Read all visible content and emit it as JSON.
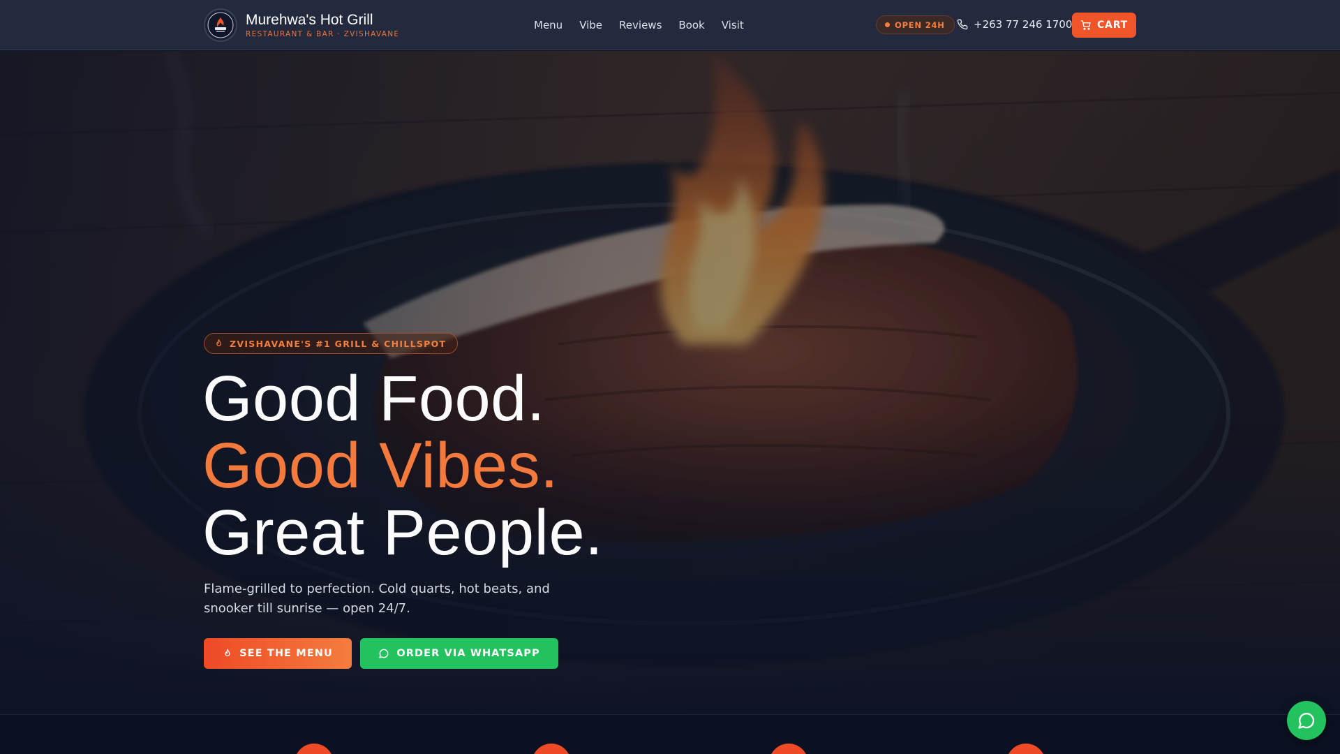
{
  "brand": {
    "name": "Murehwa's Hot Grill",
    "subtitle": "RESTAURANT & BAR · ZVISHAVANE"
  },
  "nav": {
    "links": [
      "Menu",
      "Vibe",
      "Reviews",
      "Book",
      "Visit"
    ]
  },
  "header": {
    "status": "OPEN 24H",
    "phone": "+263 77 246 1700",
    "cart_label": "CART"
  },
  "hero": {
    "tagline": "ZVISHAVANE'S #1 GRILL & CHILLSPOT",
    "headline_1": "Good Food.",
    "headline_2": "Good Vibes.",
    "headline_3": "Great People.",
    "lead": "Flame-grilled to perfection. Cold quarts, hot beats, and snooker till sunrise — open 24/7.",
    "cta_menu": "SEE THE MENU",
    "cta_whatsapp": "ORDER VIA WHATSAPP"
  },
  "colors": {
    "accent": "#f3793c",
    "cta_red": "#ee4a26",
    "whatsapp_green": "#22c25e",
    "nav_bg": "#232a3e",
    "page_bg": "#0d1326"
  },
  "icons": {
    "logo": "grill-logo-icon",
    "status": "status-dot-icon",
    "phone": "phone-icon",
    "cart": "cart-icon",
    "tagline": "flame-icon",
    "menu_cta": "flame-icon",
    "whatsapp_cta": "chat-bubble-icon",
    "float": "whatsapp-chat-icon"
  }
}
